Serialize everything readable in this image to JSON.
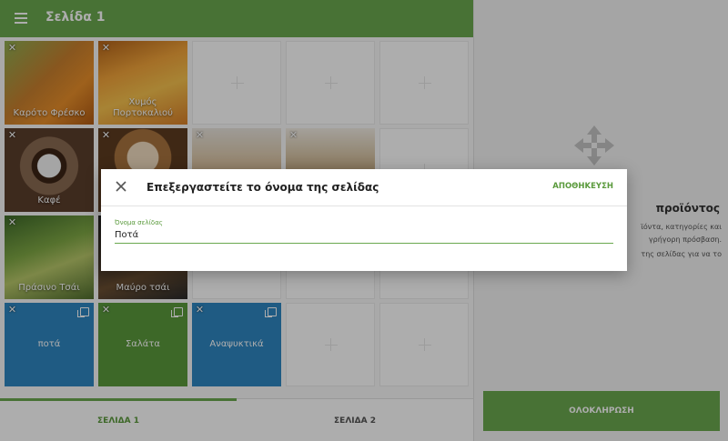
{
  "topbar": {
    "title": "Σελίδα 1",
    "menu_icon": "hamburger-menu-icon"
  },
  "colors": {
    "brand_green": "#6aa84f",
    "category_blue": "#2e86c1",
    "category_green": "#5a9a3c"
  },
  "tiles": [
    {
      "label": "Καρότο Φρέσκο",
      "kind": "product"
    },
    {
      "label": "Χυμός Πορτοκαλιού",
      "kind": "product"
    },
    {
      "label": "Καφέ",
      "kind": "product"
    },
    {
      "label": "",
      "kind": "product"
    },
    {
      "label": "",
      "kind": "product"
    },
    {
      "label": "",
      "kind": "product"
    },
    {
      "label": "Πράσινο Τσάι",
      "kind": "product"
    },
    {
      "label": "Μαύρο τσάι",
      "kind": "product"
    },
    {
      "label": "ποτά",
      "kind": "category"
    },
    {
      "label": "Σαλάτα",
      "kind": "category"
    },
    {
      "label": "Αναψυκτικά",
      "kind": "category"
    }
  ],
  "bottom_tabs": [
    {
      "label": "ΣΕΛΙΔΑ 1",
      "selected": true
    },
    {
      "label": "ΣΕΛΙΔΑ 2",
      "selected": false
    }
  ],
  "right_panel": {
    "icon": "move-arrows-icon",
    "title": "προϊόντος",
    "description": "ϊόντα, κατηγορίες και\nγρήγορη πρόσβαση.",
    "hint": "της σελίδας για να το",
    "complete_label": "ΟΛΟΚΛΗΡΩΣΗ"
  },
  "dialog": {
    "title": "Επεξεργαστείτε το όνομα της σελίδας",
    "save_label": "ΑΠΟΘΗΚΕΥΣΗ",
    "field_label": "Όνομα σελίδας",
    "field_value": "Ποτά"
  }
}
